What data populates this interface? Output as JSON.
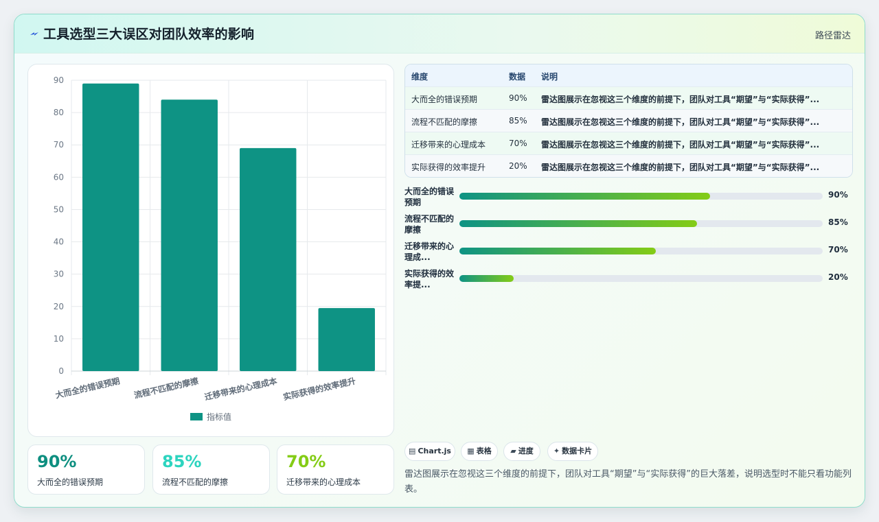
{
  "header": {
    "title": "工具选型三大误区对团队效率的影响",
    "right_label": "路径雷达",
    "icon": "lightning-icon"
  },
  "chart_data": {
    "type": "bar",
    "categories": [
      "大而全的错误预期",
      "流程不匹配的摩擦",
      "迁移带来的心理成本",
      "实际获得的效率提升"
    ],
    "series": [
      {
        "name": "指标值",
        "values": [
          89,
          84,
          69,
          19.5
        ]
      }
    ],
    "ylim": [
      0,
      90
    ],
    "yticks": [
      "0",
      "10",
      "20",
      "30",
      "40",
      "50",
      "60",
      "70",
      "80",
      "90"
    ],
    "grid": true,
    "legend": "bottom",
    "color": "#0e9384"
  },
  "stats": [
    {
      "value": "90%",
      "label": "大而全的错误预期",
      "color": "#0e8f80"
    },
    {
      "value": "85%",
      "label": "流程不匹配的摩擦",
      "color": "#2dd4bf"
    },
    {
      "value": "70%",
      "label": "迁移带来的心理成本",
      "color": "#84cc16"
    }
  ],
  "table": {
    "headers": [
      "维度",
      "数据",
      "说明"
    ],
    "rows": [
      [
        "大而全的错误预期",
        "90%",
        "雷达图展示在忽视这三个维度的前提下，团队对工具“期望”与“实际获得”..."
      ],
      [
        "流程不匹配的摩擦",
        "85%",
        "雷达图展示在忽视这三个维度的前提下，团队对工具“期望”与“实际获得”..."
      ],
      [
        "迁移带来的心理成本",
        "70%",
        "雷达图展示在忽视这三个维度的前提下，团队对工具“期望”与“实际获得”..."
      ],
      [
        "实际获得的效率提升",
        "20%",
        "雷达图展示在忽视这三个维度的前提下，团队对工具“期望”与“实际获得”..."
      ]
    ]
  },
  "progress": [
    {
      "label": "大而全的错误预期",
      "pct_text": "90%",
      "fraction": 0.69
    },
    {
      "label": "流程不匹配的摩擦",
      "pct_text": "85%",
      "fraction": 0.655
    },
    {
      "label": "迁移带来的心理成本",
      "label_display": "迁移带来的心理成...",
      "pct_text": "70%",
      "fraction": 0.54
    },
    {
      "label": "实际获得的效率提升",
      "label_display": "实际获得的效率提...",
      "pct_text": "20%",
      "fraction": 0.15
    }
  ],
  "chips": [
    {
      "icon": "▤",
      "label": "Chart.js"
    },
    {
      "icon": "▦",
      "label": "表格"
    },
    {
      "icon": "▰",
      "label": "进度"
    },
    {
      "icon": "✦",
      "label": "数据卡片"
    }
  ],
  "description": "雷达图展示在忽视这三个维度的前提下，团队对工具“期望”与“实际获得”的巨大落差，说明选型时不能只看功能列表。"
}
